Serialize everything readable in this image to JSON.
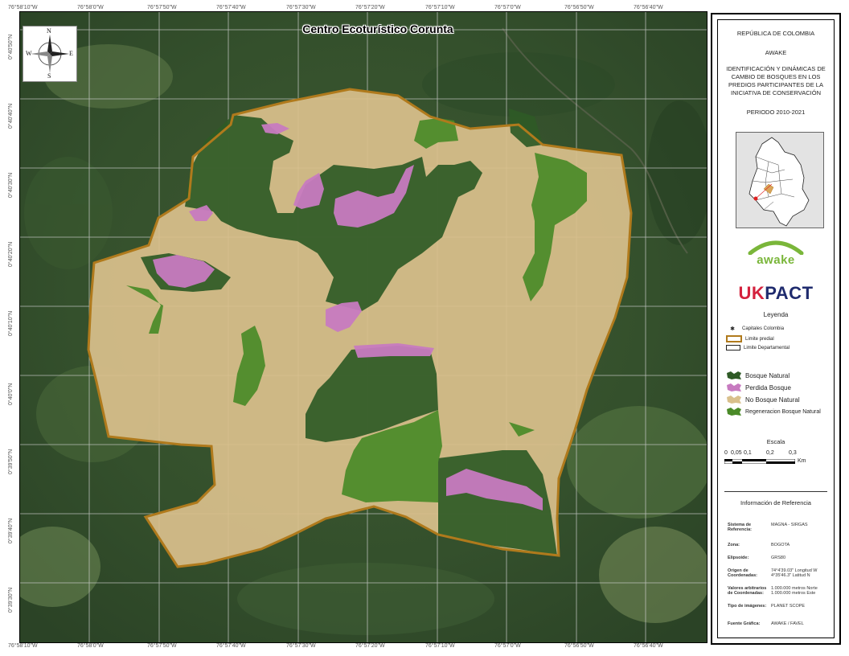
{
  "map": {
    "title": "Centro Ecoturístico Corunta",
    "top_ticks": [
      "76°58'10\"W",
      "76°58'0\"W",
      "76°57'50\"W",
      "76°57'40\"W",
      "76°57'30\"W",
      "76°57'20\"W",
      "76°57'10\"W",
      "76°57'0\"W",
      "76°56'50\"W",
      "76°56'40\"W"
    ],
    "bottom_ticks": [
      "76°58'10\"W",
      "76°58'0\"W",
      "76°57'50\"W",
      "76°57'40\"W",
      "76°57'30\"W",
      "76°57'20\"W",
      "76°57'10\"W",
      "76°57'0\"W",
      "76°56'50\"W",
      "76°56'40\"W"
    ],
    "left_ticks": [
      "0°40'50\"N",
      "0°40'40\"N",
      "0°40'30\"N",
      "0°40'20\"N",
      "0°40'10\"N",
      "0°40'0\"N",
      "0°39'50\"N",
      "0°39'40\"N",
      "0°39'30\"N"
    ],
    "compass": {
      "n": "N",
      "s": "S",
      "e": "E",
      "w": "W"
    },
    "colors": {
      "no_bosque": "#d9c08c",
      "bosque": "#2f5a26",
      "regeneracion": "#4a8a28",
      "perdida": "#c77ac0",
      "boundary": "#b07a1c"
    }
  },
  "panel": {
    "country": "REPÚBLICA DE COLOMBIA",
    "org": "AWAKE",
    "report_title": "IDENTIFICACIÓN Y DINÁMICAS DE CAMBIO DE BOSQUES EN LOS PREDIOS PARTICIPANTES DE LA INICIATIVA DE CONSERVACIÓN",
    "period": "PERIODO 2010-2021",
    "logo_awake": "awake",
    "logo_ukpact_a": "UK",
    "logo_ukpact_b": "PACT",
    "legend_title": "Leyenda",
    "legend_small": [
      {
        "label": "Capitales Colombia"
      },
      {
        "label": "Limite predial"
      },
      {
        "label": "Limite Departamental"
      }
    ],
    "legend_classes": [
      {
        "label": "Bosque Natural",
        "color": "#2f5a26"
      },
      {
        "label": "Perdida Bosque",
        "color": "#c77ac0"
      },
      {
        "label": "No Bosque Natural",
        "color": "#d9c08c"
      },
      {
        "label": "Regeneracion Bosque Natural",
        "color": "#4a8a28"
      }
    ],
    "scale_title": "Escala",
    "scale_ticks": [
      "0",
      "0,05",
      "0,1",
      "0,2",
      "0,3"
    ],
    "scale_unit": "Km",
    "ref_title": "Información de Referencia",
    "ref_rows": [
      {
        "k": "Sistema de Referencia:",
        "v": "MAGNA - SIRGAS"
      },
      {
        "k": "Zona:",
        "v": "BOGOTA"
      },
      {
        "k": "Elipsoide:",
        "v": "GRS80"
      },
      {
        "k": "Origen de Coordenadas:",
        "v": "74°4'39.03\" Longitud W  4°35'46.3\" Latitud N"
      },
      {
        "k": "Valores arbitrarios de Coordenadas:",
        "v": "1.000.000 metros Norte  1.000.000 metros Este"
      },
      {
        "k": "Tipo de imágenes:",
        "v": "PLANET SCOPE"
      },
      {
        "k": "Fuente Gráfica:",
        "v": "AWAKE / FAVEL"
      }
    ]
  }
}
